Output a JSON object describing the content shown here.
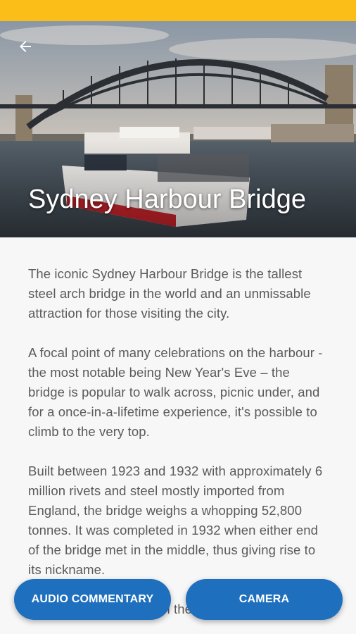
{
  "status_bar": {
    "color": "#fbbd18"
  },
  "hero": {
    "title": "Sydney Harbour Bridge",
    "back_icon": "arrow-left-icon"
  },
  "content": {
    "paragraphs": [
      "The iconic Sydney Harbour Bridge is the tallest steel arch bridge in the world and an unmissable attraction for those visiting the city.",
      "A focal point of many celebrations on the harbour - the most notable being New Year's Eve – the bridge is popular to walk across, picnic under, and for a once-in-a-lifetime experience, it's possible to climb to the very top.",
      "Built between 1923 and 1932 with approximately 6 million rivets and steel mostly imported from England, the bridge weighs a whopping 52,800 tonnes. It was completed in 1932 when either end of the bridge met in the middle, thus giving rise to its nickname.",
      "As you pass underneath the bridge, look up"
    ]
  },
  "buttons": {
    "audio_label": "AUDIO COMMENTARY",
    "camera_label": "CAMERA",
    "color": "#1f6fbf"
  }
}
